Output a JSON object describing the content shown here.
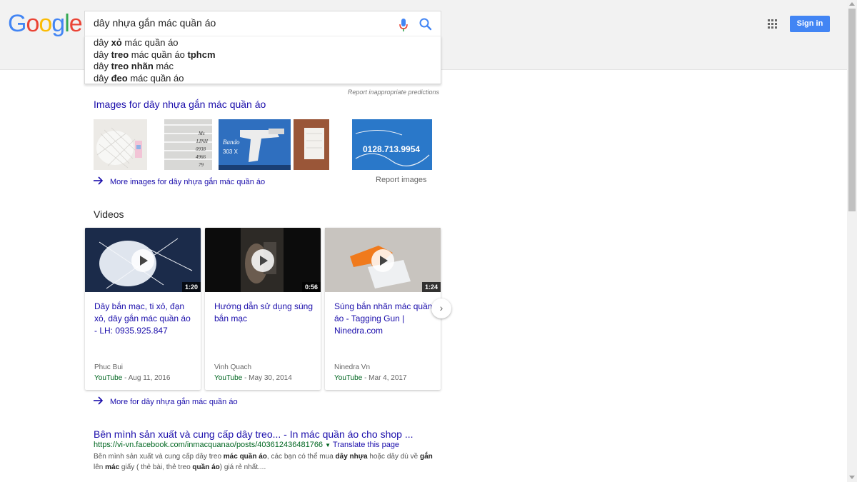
{
  "header": {
    "logo_letters": [
      {
        "ch": "G",
        "color": "#4285f4"
      },
      {
        "ch": "o",
        "color": "#ea4335"
      },
      {
        "ch": "o",
        "color": "#fbbc05"
      },
      {
        "ch": "g",
        "color": "#4285f4"
      },
      {
        "ch": "l",
        "color": "#34a853"
      },
      {
        "ch": "e",
        "color": "#ea4335"
      }
    ],
    "search_value": "dây nhựa gắn mác quần áo",
    "sign_in_label": "Sign in",
    "apps_icon": "apps-grid-icon",
    "mic_icon": "microphone-icon",
    "search_icon": "search-icon"
  },
  "suggestions": [
    [
      {
        "t": "dây ",
        "b": false
      },
      {
        "t": "xỏ",
        "b": true
      },
      {
        "t": " mác quần áo",
        "b": false
      }
    ],
    [
      {
        "t": "dây ",
        "b": false
      },
      {
        "t": "treo",
        "b": true
      },
      {
        "t": " mác quần áo ",
        "b": false
      },
      {
        "t": "tphcm",
        "b": true
      }
    ],
    [
      {
        "t": "dây ",
        "b": false
      },
      {
        "t": "treo nhãn",
        "b": true
      },
      {
        "t": " mác",
        "b": false
      }
    ],
    [
      {
        "t": "dây ",
        "b": false
      },
      {
        "t": "đeo",
        "b": true
      },
      {
        "t": " mác quần áo",
        "b": false
      }
    ]
  ],
  "report_predictions": "Report inappropriate predictions",
  "images_section": {
    "title": "Images for dây nhựa gắn mác quần áo",
    "more_label": "More images for dây nhựa gắn mác quần áo",
    "report_label": "Report images",
    "thumb_texts": [
      "Ms\nLINH\n0938\n4966\n79",
      "Bando\n303 X",
      "",
      "",
      "0128.713.9954"
    ]
  },
  "videos_section": {
    "title": "Videos",
    "more_label": "More for dây nhựa gắn mác quần áo",
    "items": [
      {
        "title": "Dây bắn mạc, ti xỏ, đạn xỏ, dây gắn mác quần áo - LH: 0935.925.847",
        "duration": "1:20",
        "author": "Phuc Bui",
        "source": "YouTube",
        "date": " - Aug 11, 2016"
      },
      {
        "title": "Hướng dẫn sử dụng súng bắn mạc",
        "duration": "0:56",
        "author": "Vinh Quach",
        "source": "YouTube",
        "date": " - May 30, 2014"
      },
      {
        "title": "Súng bắn nhãn mác quần áo - Tagging Gun | Ninedra.com",
        "duration": "1:24",
        "author": "Ninedra Vn",
        "source": "YouTube",
        "date": " - Mar 4, 2017"
      }
    ]
  },
  "result": {
    "title": "Bên mình sản xuất và cung cấp dây treo... - In mác quần áo cho shop ...",
    "url": "https://vi-vn.facebook.com/inmacquanao/posts/403612436481766",
    "translate_label": "Translate this page",
    "snippet": [
      {
        "t": "Bên mình sản xuất và cung cấp dây treo ",
        "b": false
      },
      {
        "t": "mác quần áo",
        "b": true
      },
      {
        "t": ", các bạn có thể mua ",
        "b": false
      },
      {
        "t": "dây nhựa",
        "b": true
      },
      {
        "t": " hoặc dây dù về ",
        "b": false
      },
      {
        "t": "gắn",
        "b": true
      },
      {
        "t": " lên ",
        "b": false
      },
      {
        "t": "mác",
        "b": true
      },
      {
        "t": " giấy ( thẻ bài, thẻ treo ",
        "b": false
      },
      {
        "t": "quần áo",
        "b": true
      },
      {
        "t": ") giá rẻ nhất....",
        "b": false
      }
    ]
  }
}
